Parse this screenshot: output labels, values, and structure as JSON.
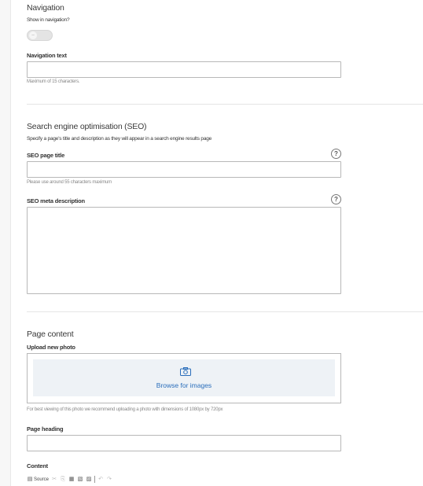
{
  "navigation": {
    "title": "Navigation",
    "show_label": "Show in navigation?",
    "toggle_on": false,
    "nav_text_label": "Navigation text",
    "nav_text_value": "",
    "nav_text_hint": "Maximum of 15 characters."
  },
  "seo": {
    "title": "Search engine optimisation (SEO)",
    "description": "Specify a page's title and description as they will appear in a search engine results page",
    "page_title_label": "SEO page title",
    "page_title_value": "",
    "page_title_hint": "Please use around 55 characters maximum",
    "meta_label": "SEO meta description",
    "meta_value": "",
    "help_glyph": "?"
  },
  "content": {
    "title": "Page content",
    "upload_label": "Upload new photo",
    "browse_label": "Browse for images",
    "upload_hint": "For best viewing of this photo we recommend uploading a photo with dimensions of 1080px by 720px",
    "heading_label": "Page heading",
    "heading_value": "",
    "content_label": "Content",
    "toolbar": {
      "source_label": "Source",
      "icons": [
        "source-icon",
        "cut-icon",
        "copy-icon",
        "paste-icon",
        "paste-text-icon",
        "paste-word-icon",
        "undo-icon",
        "redo-icon"
      ]
    }
  },
  "colors": {
    "link": "#2a6ebb",
    "upload_bg": "#eef2f6",
    "border": "#b8b8b8"
  }
}
